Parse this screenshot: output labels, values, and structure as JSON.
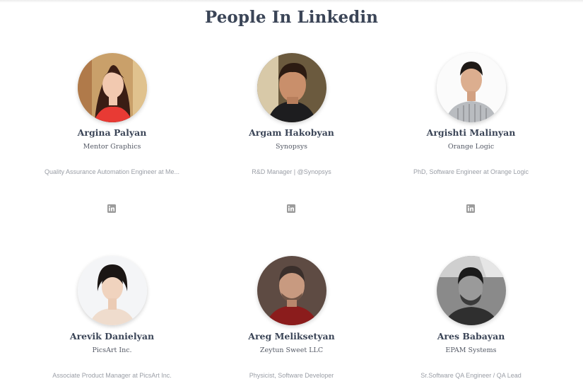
{
  "section": {
    "title": "People In Linkedin"
  },
  "people": [
    {
      "name": "Argina Palyan",
      "company": "Mentor Graphics",
      "headline": "Quality Assurance Automation Engineer at Me...",
      "icon": "linkedin-icon"
    },
    {
      "name": "Argam Hakobyan",
      "company": "Synopsys",
      "headline": "R&D Manager | @Synopsys",
      "icon": "linkedin-icon"
    },
    {
      "name": "Argishti Malinyan",
      "company": "Orange Logic",
      "headline": "PhD, Software Engineer at Orange Logic",
      "icon": "linkedin-icon"
    },
    {
      "name": "Arevik Danielyan",
      "company": "PicsArt Inc.",
      "headline": "Associate Product Manager at PicsArt Inc.",
      "icon": "linkedin-icon"
    },
    {
      "name": "Areg Meliksetyan",
      "company": "Zeytun Sweet LLC",
      "headline": "Physicist, Software Developer",
      "icon": "linkedin-icon"
    },
    {
      "name": "Ares Babayan",
      "company": "EPAM Systems",
      "headline": "Sr.Software QA Engineer / QA Lead",
      "icon": "linkedin-icon"
    }
  ],
  "colors": {
    "title": "#3b4557",
    "name": "#3b4557",
    "headline": "#9a9ea6",
    "icon": "#9b9b9b"
  }
}
